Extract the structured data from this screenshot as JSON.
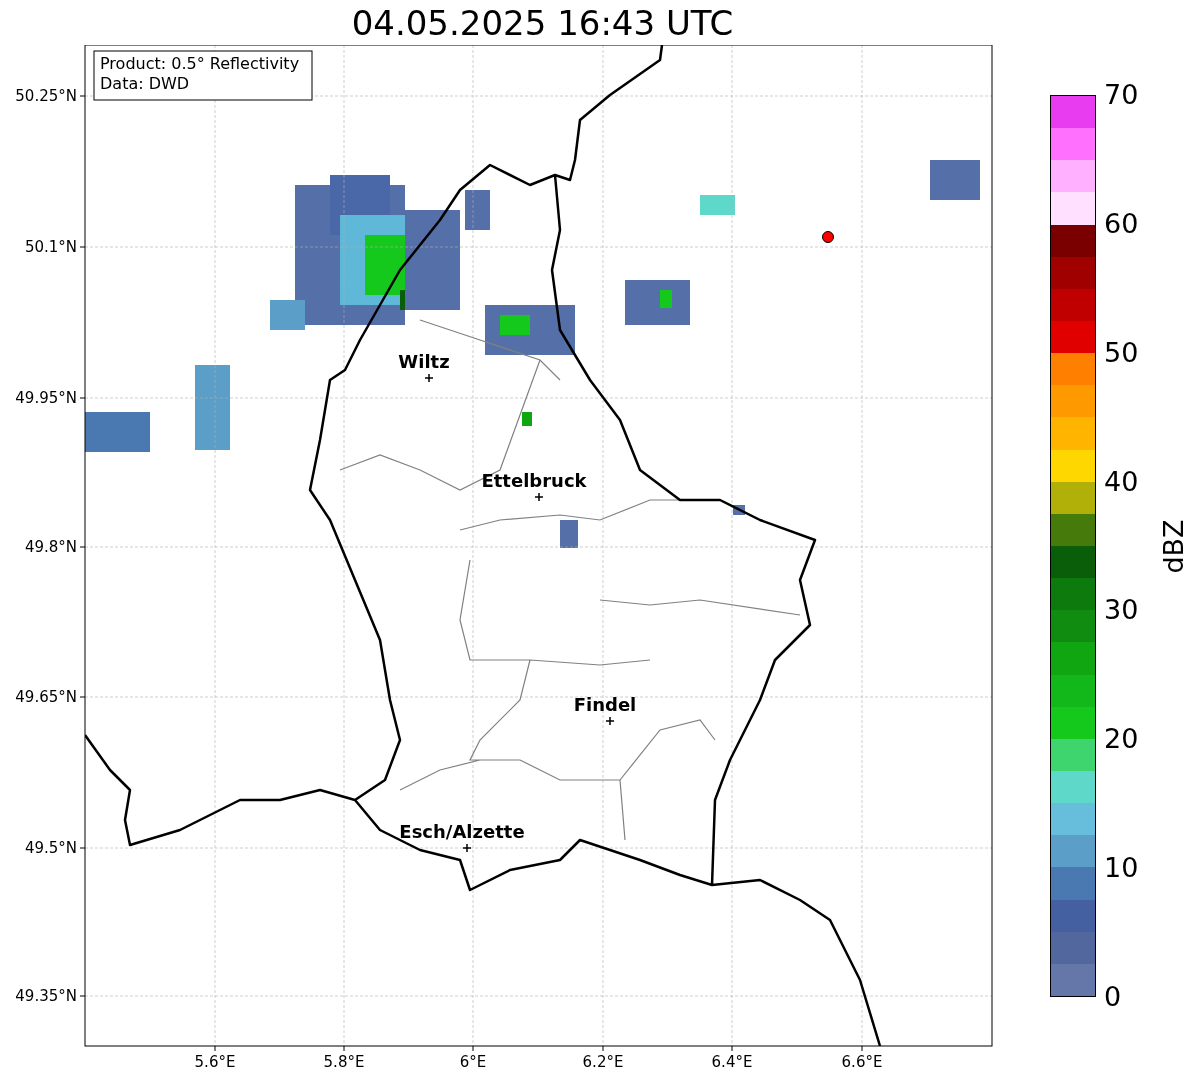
{
  "title": "04.05.2025 16:43 UTC",
  "map": {
    "info": [
      "Product: 0.5° Reflectivity",
      "Data: DWD"
    ],
    "x_ticks": [
      "5.6°E",
      "5.8°E",
      "6°E",
      "6.2°E",
      "6.4°E",
      "6.6°E"
    ],
    "y_ticks": [
      "50.25°N",
      "50.1°N",
      "49.95°N",
      "49.8°N",
      "49.65°N",
      "49.5°N",
      "49.35°N"
    ],
    "cities": [
      {
        "name": "Wiltz"
      },
      {
        "name": "Ettelbruck"
      },
      {
        "name": "Findel"
      },
      {
        "name": "Esch/Alzette"
      }
    ]
  },
  "colorbar": {
    "label": "dBZ",
    "ticks": [
      "70",
      "60",
      "50",
      "40",
      "30",
      "20",
      "10",
      "0"
    ],
    "bins": [
      {
        "color": "#e83cf0"
      },
      {
        "color": "#ff70ff"
      },
      {
        "color": "#ffb0ff"
      },
      {
        "color": "#ffe0ff"
      },
      {
        "color": "#7a0000"
      },
      {
        "color": "#a00000"
      },
      {
        "color": "#c00000"
      },
      {
        "color": "#e00000"
      },
      {
        "color": "#ff7f00"
      },
      {
        "color": "#ff9900"
      },
      {
        "color": "#ffb400"
      },
      {
        "color": "#ffd700"
      },
      {
        "color": "#b0b008"
      },
      {
        "color": "#467a0a"
      },
      {
        "color": "#0a5e0a"
      },
      {
        "color": "#0c7a0c"
      },
      {
        "color": "#108c10"
      },
      {
        "color": "#10a612"
      },
      {
        "color": "#12b81a"
      },
      {
        "color": "#14c81c"
      },
      {
        "color": "#3ed46e"
      },
      {
        "color": "#5ed8c8"
      },
      {
        "color": "#66bedc"
      },
      {
        "color": "#5b9ec8"
      },
      {
        "color": "#4a78b0"
      },
      {
        "color": "#4560a0"
      },
      {
        "color": "#53679f"
      },
      {
        "color": "#6577a8"
      }
    ]
  }
}
